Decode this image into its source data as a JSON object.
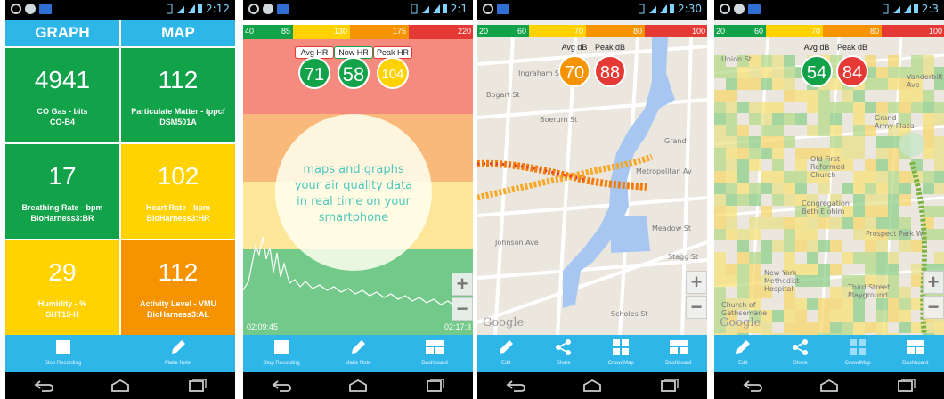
{
  "colors": {
    "green": "#12a24a",
    "yellow": "#ffd200",
    "orange": "#f59300",
    "red": "#e53935",
    "blue": "#2fb6e8"
  },
  "status": {
    "clocks": [
      "2:12",
      "2:1",
      "2:30",
      "2:3"
    ]
  },
  "panel1": {
    "tabs": [
      "GRAPH",
      "MAP"
    ],
    "tiles": [
      {
        "value": "4941",
        "label": "CO Gas - bits",
        "sensor": "CO-B4",
        "color": "green"
      },
      {
        "value": "112",
        "label": "Particulate Matter - tppcf",
        "sensor": "DSM501A",
        "color": "green"
      },
      {
        "value": "17",
        "label": "Breathing Rate - bpm",
        "sensor": "BioHarness3:BR",
        "color": "green"
      },
      {
        "value": "102",
        "label": "Heart Rate - bpm",
        "sensor": "BioHarness3:HR",
        "color": "yellow"
      },
      {
        "value": "29",
        "label": "Humidity - %",
        "sensor": "SHT15-H",
        "color": "yellow"
      },
      {
        "value": "112",
        "label": "Activity Level - VMU",
        "sensor": "BioHarness3:AL",
        "color": "orange"
      }
    ],
    "actions": [
      "Stop Recording",
      "Make Note"
    ]
  },
  "panel2": {
    "scale": [
      "40",
      "85",
      "130",
      "175",
      "220"
    ],
    "avg_label": "Avg HR",
    "avg_value": "71",
    "now_label": "Now HR",
    "now_value": "58",
    "peak_label": "Peak HR",
    "peak_value": "104",
    "bubble": [
      "maps and graphs",
      "your air quality data",
      "in real time on your",
      "smartphone"
    ],
    "time_start": "02:09:45",
    "time_end": "02:17:3",
    "zoom_in": "+",
    "zoom_out": "−",
    "actions": [
      "Stop Recording",
      "Make Note",
      "Dashboard"
    ]
  },
  "panel3": {
    "scale": [
      "20",
      "60",
      "70",
      "80",
      "100"
    ],
    "avg_label": "Avg dB",
    "avg_value": "70",
    "peak_label": "Peak dB",
    "peak_value": "88",
    "streets": [
      "Ingraham St",
      "Grand",
      "Metropolitan Av",
      "Meadow St",
      "Stagg St",
      "Scholes St",
      "Boerum St",
      "Bogart St",
      "Johnson Ave"
    ],
    "logo": "Google",
    "zoom_in": "+",
    "zoom_out": "−",
    "actions": [
      "Edit",
      "Share",
      "CrowdMap",
      "Dashboard"
    ]
  },
  "panel4": {
    "scale": [
      "20",
      "60",
      "70",
      "80",
      "100"
    ],
    "avg_label": "Avg dB",
    "avg_value": "54",
    "peak_label": "Peak dB",
    "peak_value": "84",
    "streets": [
      "Union St",
      "Grand Army Plaza",
      "Old First Reformed Church",
      "Congregation Beth Elohim",
      "New York Methodist Hospital",
      "Third Street Playground",
      "Church of Gethsemane",
      "Vanderbilt Ave",
      "Prospect Park W"
    ],
    "logo": "Google",
    "zoom_in": "+",
    "zoom_out": "−",
    "actions": [
      "Edit",
      "Share",
      "CrowdMap",
      "Dashboard"
    ]
  }
}
